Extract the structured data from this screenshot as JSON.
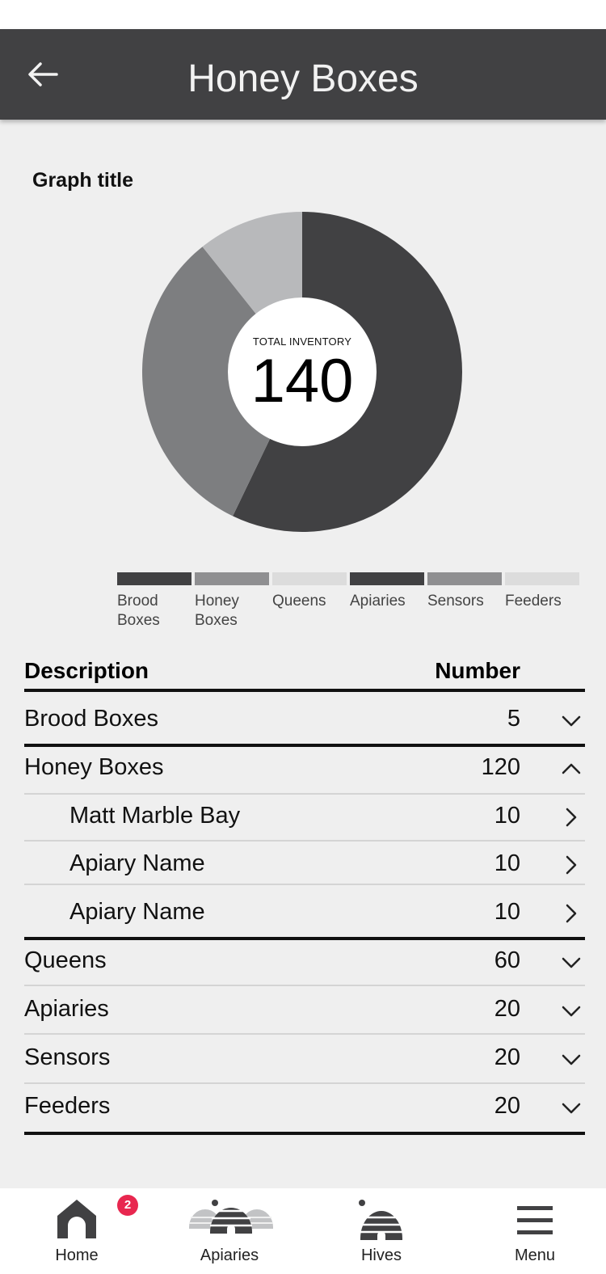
{
  "header": {
    "title": "Honey Boxes"
  },
  "graph": {
    "title": "Graph title",
    "center_label": "TOTAL INVENTORY",
    "center_total": "140"
  },
  "chart_data": {
    "type": "pie",
    "title": "Graph title",
    "slices": [
      {
        "label": "Brood Boxes",
        "value": 80,
        "color": "#414143"
      },
      {
        "label": "Honey Boxes",
        "value": 45,
        "color": "#7d7e80"
      },
      {
        "label": "Queens",
        "value": 15,
        "color": "#b8b9bb"
      }
    ],
    "total": 140,
    "legend": [
      {
        "label": "Brood\nBoxes",
        "color": "#414143"
      },
      {
        "label": "Honey\nBoxes",
        "color": "#8f8f91"
      },
      {
        "label": "Queens",
        "color": "#dcdcdc"
      },
      {
        "label": "Apiaries",
        "color": "#414143"
      },
      {
        "label": "Sensors",
        "color": "#8f8f91"
      },
      {
        "label": "Feeders",
        "color": "#dcdcdc"
      }
    ]
  },
  "table": {
    "headers": {
      "description": "Description",
      "number": "Number"
    },
    "rows": [
      {
        "description": "Brood Boxes",
        "number": "5",
        "icon": "chevron-down-icon",
        "level": 0
      },
      {
        "description": "Honey Boxes",
        "number": "120",
        "icon": "chevron-up-icon",
        "level": 0
      },
      {
        "description": "Matt Marble Bay",
        "number": "10",
        "icon": "chevron-right-icon",
        "level": 1
      },
      {
        "description": "Apiary Name",
        "number": "10",
        "icon": "chevron-right-icon",
        "level": 1
      },
      {
        "description": "Apiary Name",
        "number": "10",
        "icon": "chevron-right-icon",
        "level": 1
      },
      {
        "description": "Queens",
        "number": "60",
        "icon": "chevron-down-icon",
        "level": 0
      },
      {
        "description": "Apiaries",
        "number": "20",
        "icon": "chevron-down-icon",
        "level": 0
      },
      {
        "description": "Sensors",
        "number": "20",
        "icon": "chevron-down-icon",
        "level": 0
      },
      {
        "description": "Feeders",
        "number": "20",
        "icon": "chevron-down-icon",
        "level": 0
      }
    ]
  },
  "nav": {
    "items": [
      {
        "label": "Home",
        "icon": "home-icon",
        "badge": "2"
      },
      {
        "label": "Apiaries",
        "icon": "apiaries-icon"
      },
      {
        "label": "Hives",
        "icon": "hive-icon"
      },
      {
        "label": "Menu",
        "icon": "menu-icon"
      }
    ]
  },
  "colors": {
    "header_bg": "#414143",
    "badge": "#e8274f",
    "background": "#efefef"
  }
}
